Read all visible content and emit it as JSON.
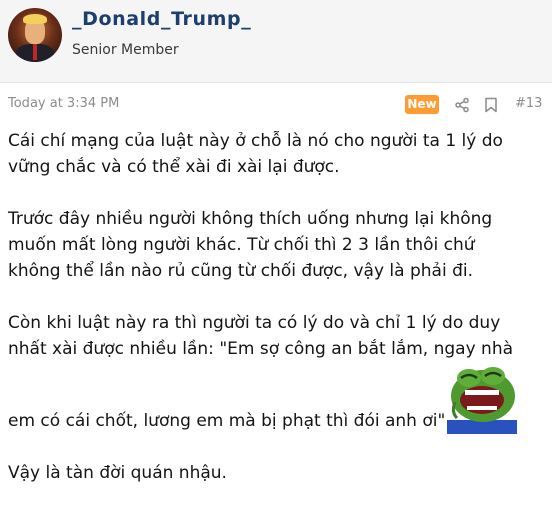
{
  "user": {
    "name": "_Donald_Trump_",
    "title": "Senior Member",
    "avatar_icon": "avatar-image"
  },
  "meta": {
    "time": "Today at 3:34 PM",
    "badge": "New",
    "post_number": "#13",
    "share_icon": "share-icon",
    "bookmark_icon": "bookmark-icon"
  },
  "body": {
    "p1_l1": "Cái chí mạng của luật này ở chỗ là nó cho người ta 1 lý do",
    "p1_l2": "vững chắc và có thể xài đi xài lại được.",
    "p2_l1": "Trước đây nhiều người không thích uống nhưng lại không",
    "p2_l2": "muốn mất lòng người khác. Từ chối thì 2 3 lần thôi chứ",
    "p2_l3": "không thể lần nào rủ cũng từ chối được, vậy là phải đi.",
    "p3_l1": "Còn khi luật này ra thì người ta có lý do và chỉ 1 lý do duy",
    "p3_l2": "nhất xài được nhiều lần: \"Em sợ công an bắt lắm, ngay nhà",
    "p3_l3": "em có cái chốt, lương em mà bị phạt thì đói anh ơi\"",
    "p4_l1": "Vậy là tàn đời quán nhậu.",
    "emoji": "laughing-frog-emoji"
  },
  "colors": {
    "username": "#1d3f6e",
    "badge_bg": "#fe9b33",
    "header_bg": "#f5f5f5",
    "meta_text": "#8c8c8c"
  }
}
